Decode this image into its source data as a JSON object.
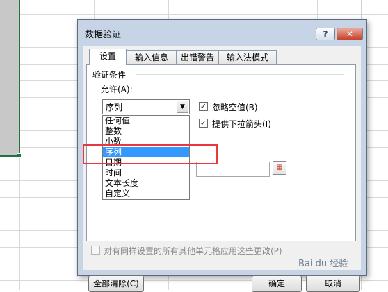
{
  "dialog": {
    "title": "数据验证",
    "help": "?",
    "close": "✕"
  },
  "tabs": [
    {
      "label": "设置",
      "active": true
    },
    {
      "label": "输入信息",
      "active": false
    },
    {
      "label": "出错警告",
      "active": false
    },
    {
      "label": "输入法模式",
      "active": false
    }
  ],
  "settings": {
    "section_title": "验证条件",
    "allow_label": "允许(A):",
    "allow_value": "序列",
    "allow_options": [
      "任何值",
      "整数",
      "小数",
      "序列",
      "日期",
      "时间",
      "文本长度",
      "自定义"
    ],
    "selected_option": "序列",
    "ignore_blank_label": "忽略空值(B)",
    "ignore_blank_checked": true,
    "dropdown_label": "提供下拉箭头(I)",
    "dropdown_checked": true,
    "source_value": "",
    "apply_all_label": "对有同样设置的所有其他单元格应用这些更改(P)",
    "apply_all_checked": false
  },
  "buttons": {
    "clear_all": "全部清除(C)",
    "ok": "确定",
    "cancel": "取消"
  },
  "icons": {
    "combo_arrow": "▼",
    "check": "✓",
    "range_select": "▦"
  },
  "watermark": "Bai du 经验",
  "colors": {
    "highlight": "#3399ff",
    "annotation_box": "#e8383d",
    "cell_selection": "#1f7246"
  }
}
